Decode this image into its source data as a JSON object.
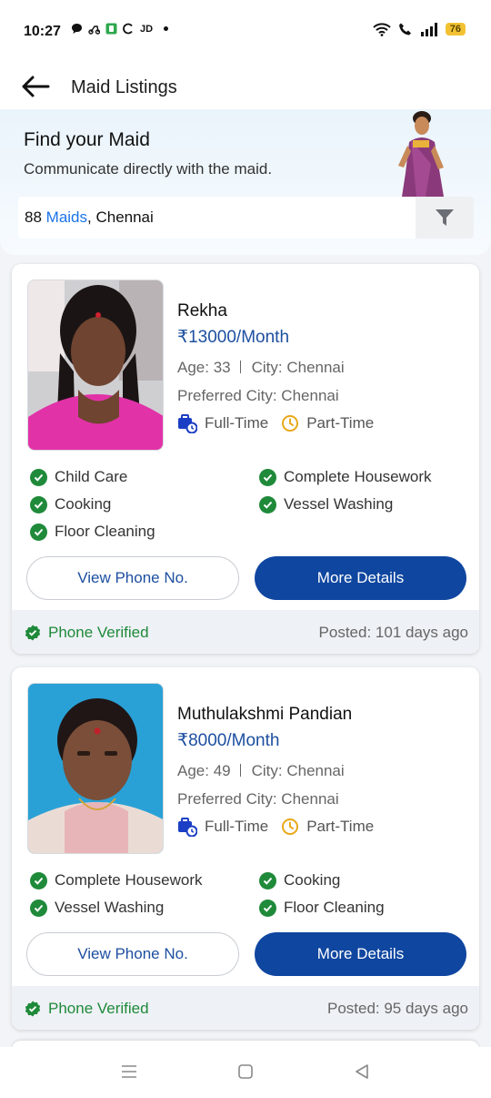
{
  "status_bar": {
    "time": "10:27",
    "notif_text": "JD",
    "battery": "76"
  },
  "app_bar": {
    "title": "Maid Listings"
  },
  "hero": {
    "title": "Find your Maid",
    "subtitle": "Communicate directly with the maid.",
    "search": {
      "count": "88",
      "link_text": "Maids",
      "city": ", Chennai"
    }
  },
  "listings": [
    {
      "name": "Rekha",
      "salary": "₹13000/Month",
      "age": "Age: 33",
      "city": "City: Chennai",
      "preferred_city": "Preferred City: Chennai",
      "job_types": [
        "Full-Time",
        "Part-Time"
      ],
      "skills": [
        "Child Care",
        "Complete Housework",
        "Cooking",
        "Vessel Washing",
        "Floor Cleaning"
      ],
      "phone_button": "View Phone No.",
      "details_button": "More Details",
      "verified": "Phone Verified",
      "posted": "Posted: 101 days ago"
    },
    {
      "name": "Muthulakshmi Pandian",
      "salary": "₹8000/Month",
      "age": "Age: 49",
      "city": "City: Chennai",
      "preferred_city": "Preferred City: Chennai",
      "job_types": [
        "Full-Time",
        "Part-Time"
      ],
      "skills": [
        "Complete Housework",
        "Cooking",
        "Vessel Washing",
        "Floor Cleaning"
      ],
      "phone_button": "View Phone No.",
      "details_button": "More Details",
      "verified": "Phone Verified",
      "posted": "Posted: 95 days ago"
    }
  ],
  "colors": {
    "brand_blue": "#0f46a0",
    "salary_blue": "#1d4fa0",
    "link_blue": "#1b73e8",
    "verified_green": "#1f8a3a"
  },
  "icons": [
    "back-arrow-icon",
    "filter-icon",
    "check-circle-icon",
    "briefcase-clock-icon",
    "clock-icon",
    "verified-badge-icon",
    "menu-icon",
    "home-square-icon",
    "back-triangle-icon"
  ]
}
